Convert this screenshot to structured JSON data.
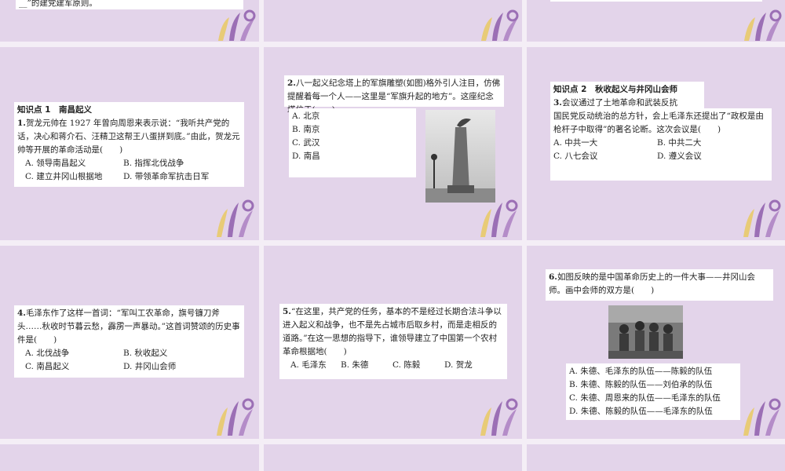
{
  "colors": {
    "slide_bg": "#e3d4ea",
    "deco_purple": "#9b6fb5",
    "deco_yellow": "#e9c85a"
  },
  "top_fragment": {
    "text": "__”的建党建军原则。"
  },
  "q1": {
    "section": "知识点 1　南昌起义",
    "stem_number": "1.",
    "stem": "贺龙元帅在 1927 年曾向周恩来表示说：“我听共产党的话，决心和蒋介石、汪精卫这帮王八蛋拼到底。”由此，贺龙元帅等开展的革命活动是(　　)",
    "options": [
      "A. 领导南昌起义",
      "B. 指挥北伐战争",
      "C. 建立井冈山根据地",
      "D. 带领革命军抗击日军"
    ]
  },
  "q2": {
    "stem_number": "2.",
    "stem": "八一起义纪念塔上的军旗雕塑(如图)格外引人注目，仿佛提醒着每一个人——这里是“军旗升起的地方”。这座纪念塔位于(　　)",
    "options": [
      "A. 北京",
      "B. 南京",
      "C. 武汉",
      "D. 南昌"
    ]
  },
  "q3": {
    "section": "知识点 2　秋收起义与井冈山会师",
    "stem_number": "3.",
    "stem_first": "会议通过了土地革命和武装反抗",
    "stem_rest": "国民党反动统治的总方针，会上毛泽东还提出了“政权是由枪杆子中取得”的著名论断。这次会议是(　　)",
    "options": [
      "A. 中共一大",
      "B. 中共二大",
      "C. 八七会议",
      "D. 遵义会议"
    ]
  },
  "q4": {
    "stem_number": "4.",
    "stem": "毛泽东作了这样一首词：“军叫工农革命，旗号镰刀斧头……秋收时节暮云愁，霹雳一声暴动。”这首词赞颂的历史事件是(　　)",
    "options": [
      "A. 北伐战争",
      "B. 秋收起义",
      "C. 南昌起义",
      "D. 井冈山会师"
    ]
  },
  "q5": {
    "stem_number": "5.",
    "stem": "“在这里，共产党的任务，基本的不是经过长期合法斗争以进入起义和战争，也不是先占城市后取乡村，而是走相反的道路。”在这一思想的指导下，谁领导建立了中国第一个农村革命根据地(　　)",
    "options": [
      "A. 毛泽东",
      "B. 朱德",
      "C. 陈毅",
      "D. 贺龙"
    ]
  },
  "q6": {
    "stem_number": "6.",
    "stem": "如图反映的是中国革命历史上的一件大事——井冈山会师。画中会师的双方是(　　)",
    "options": [
      "A. 朱德、毛泽东的队伍——陈毅的队伍",
      "B. 朱德、陈毅的队伍——刘伯承的队伍",
      "C. 朱德、周恩来的队伍——毛泽东的队伍",
      "D. 朱德、陈毅的队伍——毛泽东的队伍"
    ]
  }
}
